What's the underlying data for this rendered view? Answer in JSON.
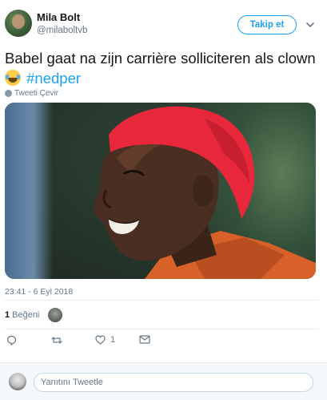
{
  "author": {
    "name": "Mila Bolt",
    "handle": "@milaboltvb"
  },
  "follow_label": "Takip et",
  "tweet": {
    "text": "Babel gaat na zijn carrière solliciteren als clown",
    "emoji": "face-with-tears-of-joy",
    "hashtag": "#nedper"
  },
  "translate_label": "Tweeti Çevir",
  "media": {
    "description": "photo"
  },
  "timestamp": "23:41 - 6 Eyl 2018",
  "likes": {
    "count": "1",
    "label": "Beğeni"
  },
  "actions": {
    "like_count": "1"
  },
  "reply": {
    "placeholder": "Yanıtını Tweetle"
  },
  "colors": {
    "accent": "#1da1f2",
    "muted": "#657786",
    "hair": "#e8283a"
  }
}
